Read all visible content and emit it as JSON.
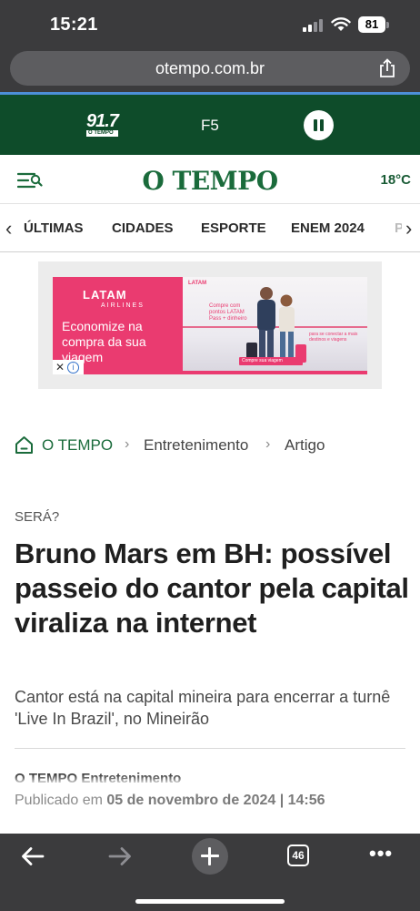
{
  "status_bar": {
    "time": "15:21",
    "battery": "81"
  },
  "browser": {
    "url": "otempo.com.br",
    "tab_count": "46"
  },
  "radio": {
    "frequency": "91.7",
    "logo_sub": "O TEMPO",
    "station": "F5"
  },
  "header": {
    "brand": "O TEMPO",
    "temperature": "18°C"
  },
  "categories": [
    "ÚLTIMAS",
    "CIDADES",
    "ESPORTE",
    "ENEM 2024",
    "POLÍTICA"
  ],
  "ad": {
    "brand": "LATAM",
    "brand_sub": "AIRLINES",
    "headline": "Economize na compra da sua viagem",
    "close_label": "✕",
    "info_label": "i",
    "promo_text": "Compre com pontos LATAM Pass + dinheiro",
    "promo_text2": "para se conectar a mais destinos e viagens",
    "cta": "Compre sua viagem"
  },
  "breadcrumb": {
    "home": "O TEMPO",
    "section": "Entretenimento",
    "type": "Artigo"
  },
  "article": {
    "kicker": "SERÁ?",
    "headline": "Bruno Mars em BH: possível passeio do cantor pela capital viraliza na internet",
    "subtitle": "Cantor está na capital mineira para encerrar a turnê 'Live In Brazil', no Mineirão",
    "byline": "O TEMPO Entretenimento",
    "published_label": "Publicado em",
    "published_date": "05 de novembro de 2024 | 14:56"
  },
  "colors": {
    "brand_green": "#1a6b3b",
    "radio_green": "#0e4c2a",
    "ad_pink": "#ea3b70",
    "chrome": "#3b3b3d"
  }
}
